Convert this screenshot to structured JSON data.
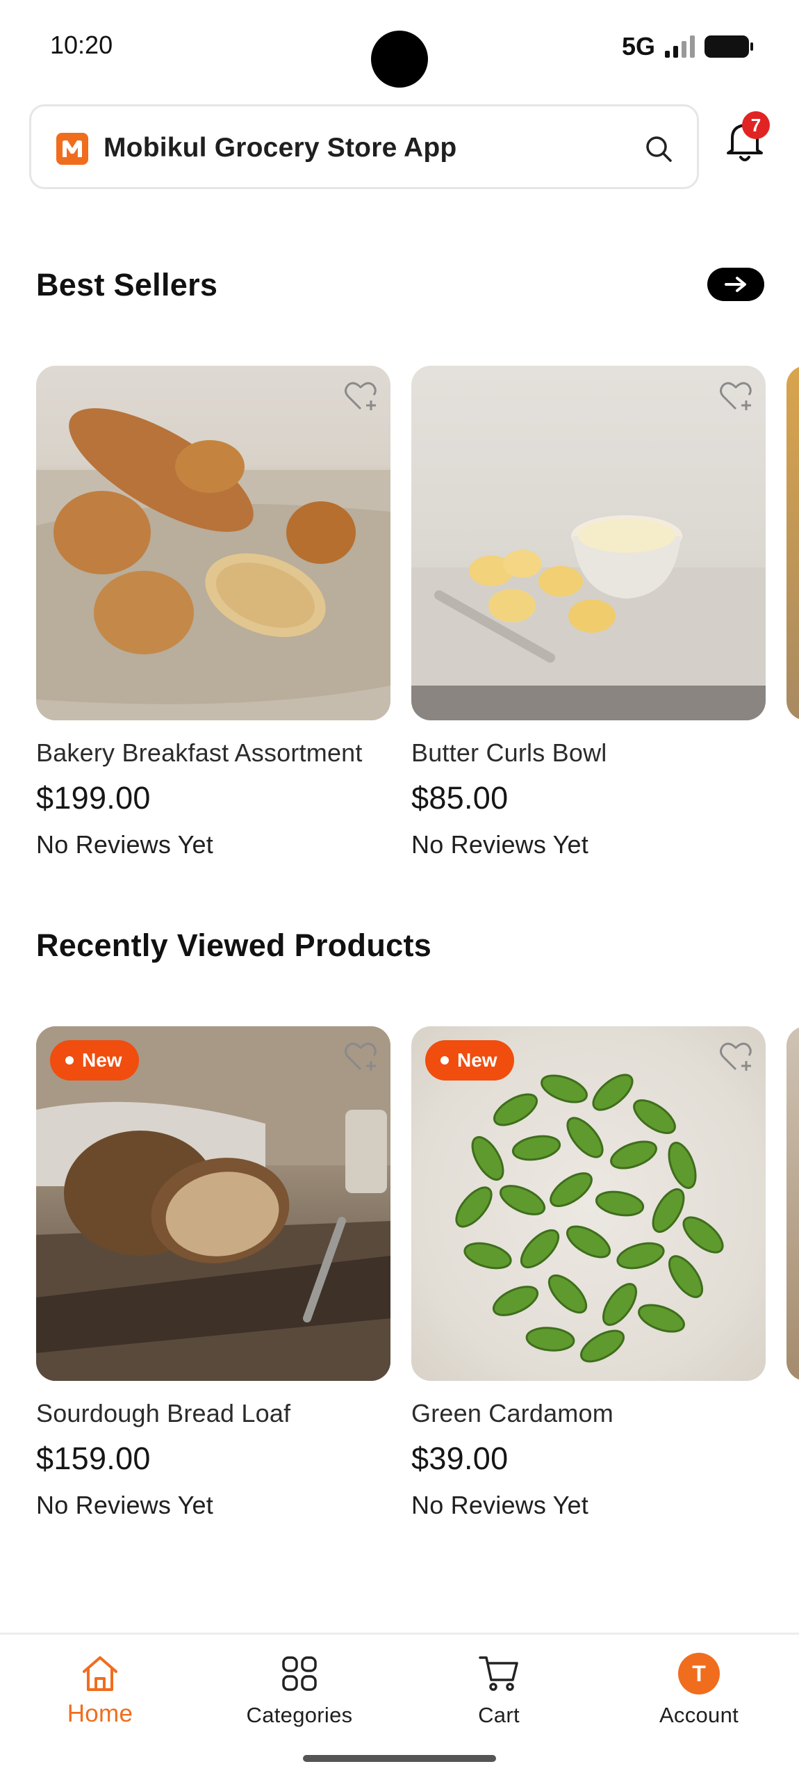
{
  "status_bar": {
    "time": "10:20",
    "network": "5G"
  },
  "header": {
    "app_name": "Mobikul Grocery Store App",
    "notification_count": "7"
  },
  "best_sellers": {
    "title": "Best Sellers",
    "products": [
      {
        "name": "Bakery Breakfast Assortment",
        "price": "$199.00",
        "reviews": "No Reviews Yet"
      },
      {
        "name": "Butter Curls Bowl",
        "price": "$85.00",
        "reviews": "No Reviews Yet"
      }
    ]
  },
  "recently_viewed": {
    "title": "Recently Viewed Products",
    "products": [
      {
        "badge": "New",
        "name": "Sourdough Bread Loaf",
        "price": "$159.00",
        "reviews": "No Reviews Yet"
      },
      {
        "badge": "New",
        "name": "Green Cardamom",
        "price": "$39.00",
        "reviews": "No Reviews Yet"
      }
    ]
  },
  "bottom_nav": {
    "items": [
      {
        "label": "Home",
        "icon": "home-icon",
        "active": true
      },
      {
        "label": "Categories",
        "icon": "categories-icon"
      },
      {
        "label": "Cart",
        "icon": "cart-icon"
      },
      {
        "label": "Account",
        "icon": "avatar",
        "initial": "T"
      }
    ]
  },
  "colors": {
    "accent": "#f06d1e",
    "badge_new": "#f04d0e",
    "notification_badge": "#e02424"
  }
}
